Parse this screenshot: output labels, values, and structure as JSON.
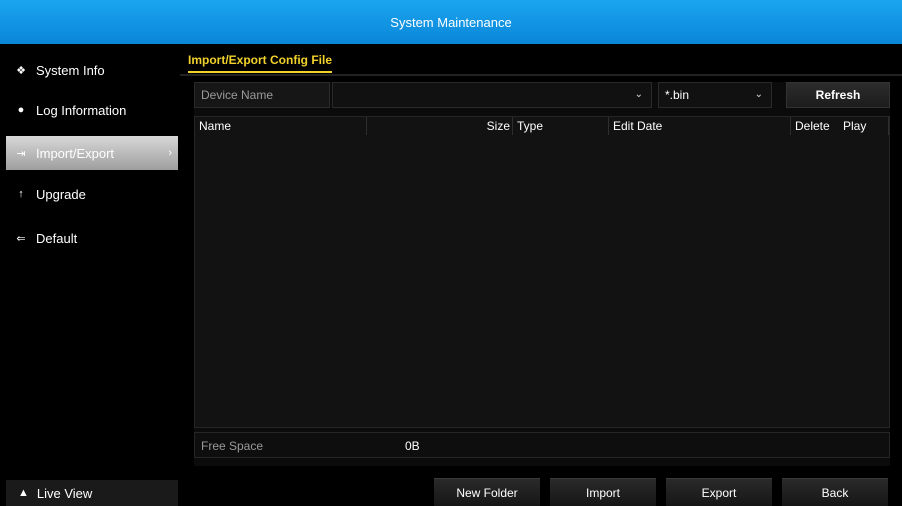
{
  "window": {
    "title": "System Maintenance"
  },
  "sidebar": {
    "items": [
      {
        "label": "System Info",
        "icon": "info-icon"
      },
      {
        "label": "Log Information",
        "icon": "log-icon"
      },
      {
        "label": "Import/Export",
        "icon": "import-export-icon",
        "active": true
      },
      {
        "label": "Upgrade",
        "icon": "upgrade-arrow-icon"
      },
      {
        "label": "Default",
        "icon": "default-icon"
      }
    ],
    "live_view": {
      "label": "Live View",
      "icon": "home-icon"
    }
  },
  "tabs": [
    {
      "label": "Import/Export Config File",
      "active": true
    }
  ],
  "toolbar": {
    "device_label": "Device Name",
    "device_value": "",
    "extension_value": "*.bin",
    "refresh_label": "Refresh"
  },
  "table": {
    "columns": [
      "Name",
      "Size",
      "Type",
      "Edit Date",
      "Delete",
      "Play"
    ],
    "rows": []
  },
  "free_space": {
    "label": "Free Space",
    "value": "0B"
  },
  "buttons": {
    "new_folder": "New Folder",
    "import": "Import",
    "export": "Export",
    "back": "Back"
  },
  "colors": {
    "title_bar": "#1aa5f0",
    "tab_accent": "#f2d22a",
    "active_item": "#bdbdbd"
  }
}
